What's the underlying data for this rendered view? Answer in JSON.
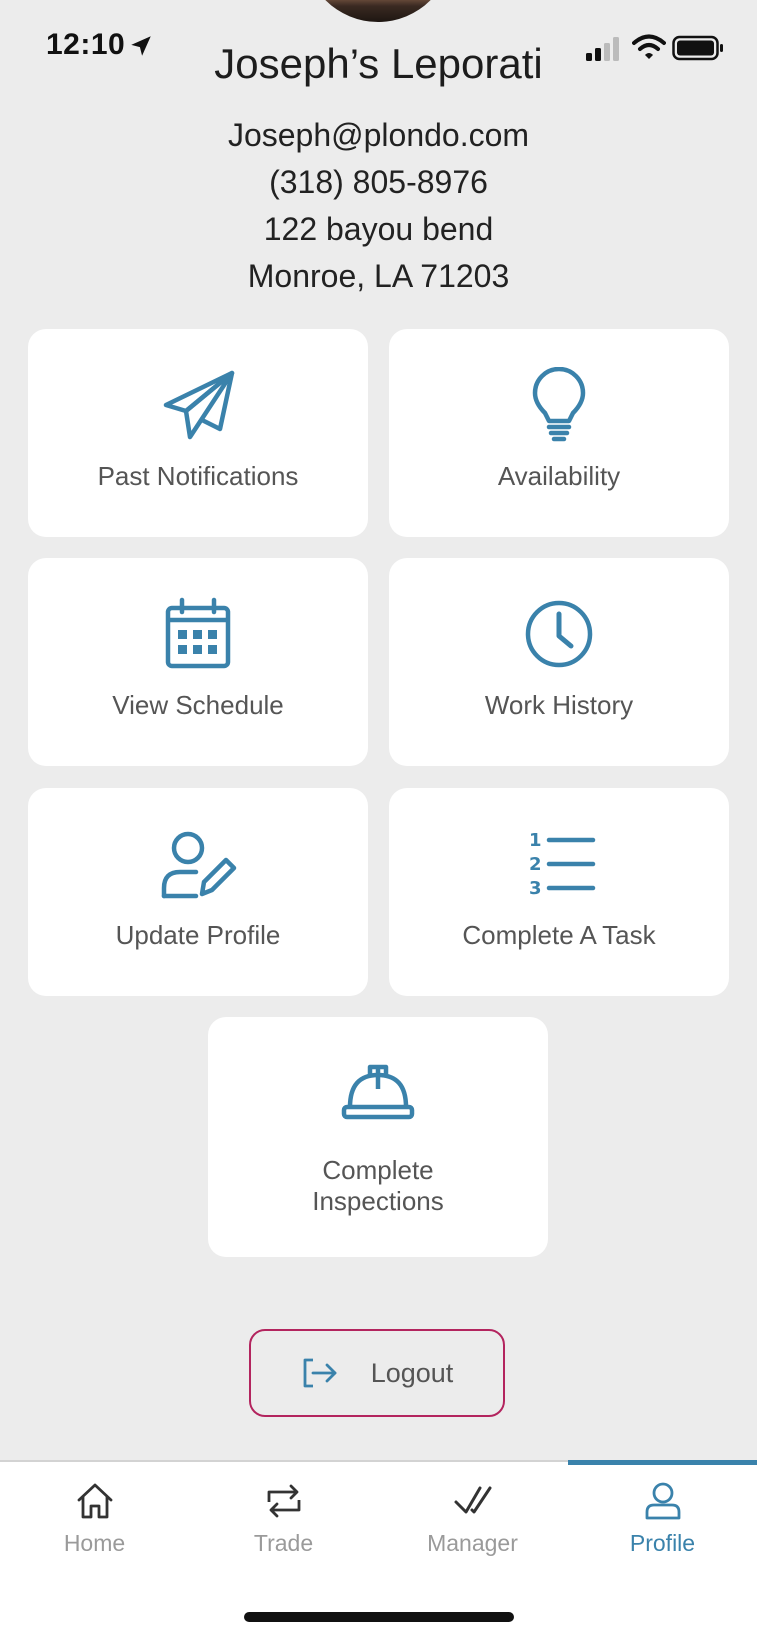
{
  "status_bar": {
    "time": "12:10"
  },
  "profile": {
    "name": "Joseph’s Leporati",
    "email": "Joseph@plondo.com",
    "phone": "(318) 805-8976",
    "address_line1": "122 bayou bend",
    "address_line2": "Monroe, LA 71203"
  },
  "tiles": [
    {
      "label": "Past Notifications",
      "icon": "paper-plane-icon"
    },
    {
      "label": "Availability",
      "icon": "lightbulb-icon"
    },
    {
      "label": "View Schedule",
      "icon": "calendar-icon"
    },
    {
      "label": "Work History",
      "icon": "clock-icon"
    },
    {
      "label": "Update Profile",
      "icon": "user-edit-icon"
    },
    {
      "label": "Complete A Task",
      "icon": "numbered-list-icon"
    },
    {
      "label": "Complete Inspections",
      "icon": "hard-hat-icon"
    }
  ],
  "logout": {
    "label": "Logout",
    "icon": "logout-icon"
  },
  "tabbar": {
    "items": [
      {
        "label": "Home",
        "icon": "home-icon"
      },
      {
        "label": "Trade",
        "icon": "trade-arrows-icon"
      },
      {
        "label": "Manager",
        "icon": "checkmark-icon"
      },
      {
        "label": "Profile",
        "icon": "profile-icon"
      }
    ],
    "active": "Profile"
  },
  "colors": {
    "accent": "#3a82ab",
    "logout_border": "#b3245e",
    "background": "#ececec"
  }
}
